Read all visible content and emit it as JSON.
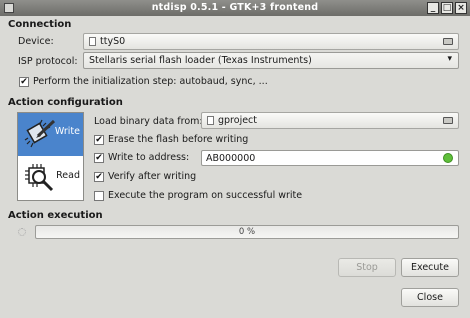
{
  "window": {
    "title": "ntdisp 0.5.1 - GTK+3 frontend"
  },
  "connection": {
    "heading": "Connection",
    "device_label": "Device:",
    "device_value": "ttyS0",
    "isp_label": "ISP protocol:",
    "isp_value": "Stellaris serial flash loader (Texas Instruments)",
    "init_step_label": "Perform the initialization step: autobaud, sync, ...",
    "init_step_checked": true
  },
  "action_configuration": {
    "heading": "Action configuration",
    "modes": [
      {
        "label": "Write",
        "icon": "chip-write-icon",
        "selected": true
      },
      {
        "label": "Read",
        "icon": "chip-read-icon",
        "selected": false
      }
    ],
    "load_label": "Load binary data from:",
    "load_value": "gproject",
    "erase_label": "Erase the flash before writing",
    "erase_checked": true,
    "write_address_label": "Write to address:",
    "write_address_checked": true,
    "write_address_value": "AB000000",
    "verify_label": "Verify after writing",
    "verify_checked": true,
    "execute_label": "Execute the program  on successful write",
    "execute_checked": false
  },
  "action_execution": {
    "heading": "Action execution",
    "progress_text": "0 %",
    "progress_fraction": 0
  },
  "buttons": {
    "stop": "Stop",
    "execute": "Execute",
    "close": "Close"
  },
  "colors": {
    "accent": "#4a84cc",
    "valid": "#5fbf3a"
  }
}
